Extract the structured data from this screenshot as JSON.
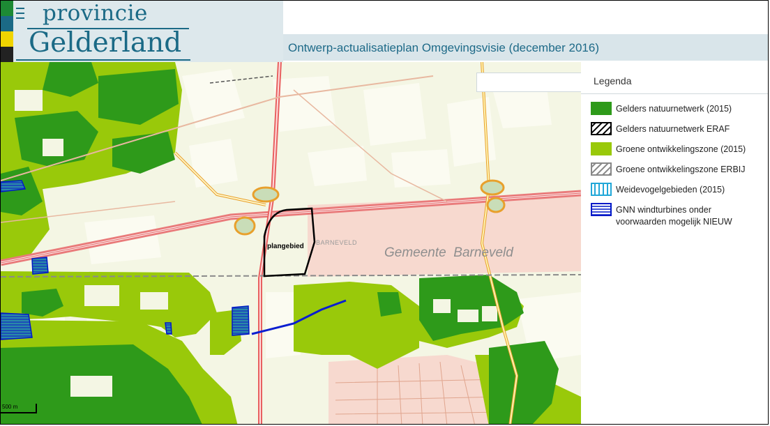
{
  "logo": {
    "line1": "provincie",
    "line2": "Gelderland",
    "stripe_colors": [
      "#1d8a34",
      "#1b6a86",
      "#f0d400",
      "#222222"
    ]
  },
  "title": "Ontwerp-actualisatieplan Omgevingsvisie (december 2016)",
  "map": {
    "area_label": "plangebied",
    "municipality_label": "Gemeente  Barneveld",
    "town_label": "BARNEVELD",
    "scale_label": "500 m"
  },
  "legend": {
    "heading": "Legenda",
    "items": [
      {
        "label": "Gelders natuurnetwerk (2015)",
        "swatch": "solid",
        "color": "#2e9a1a"
      },
      {
        "label": "Gelders natuurnetwerk ERAF",
        "swatch": "hatch-black",
        "color": "#000000"
      },
      {
        "label": "Groene ontwikkelingszone (2015)",
        "swatch": "solid",
        "color": "#99c90a"
      },
      {
        "label": "Groene ontwikkelingszone ERBIJ",
        "swatch": "hatch-grey",
        "color": "#888888"
      },
      {
        "label": "Weidevogelgebieden (2015)",
        "swatch": "vlines",
        "color": "#21a7d8"
      },
      {
        "label": "GNN windturbines onder voorwaarden mogelijk NIEUW",
        "swatch": "hlines",
        "color": "#0018c8"
      }
    ]
  }
}
